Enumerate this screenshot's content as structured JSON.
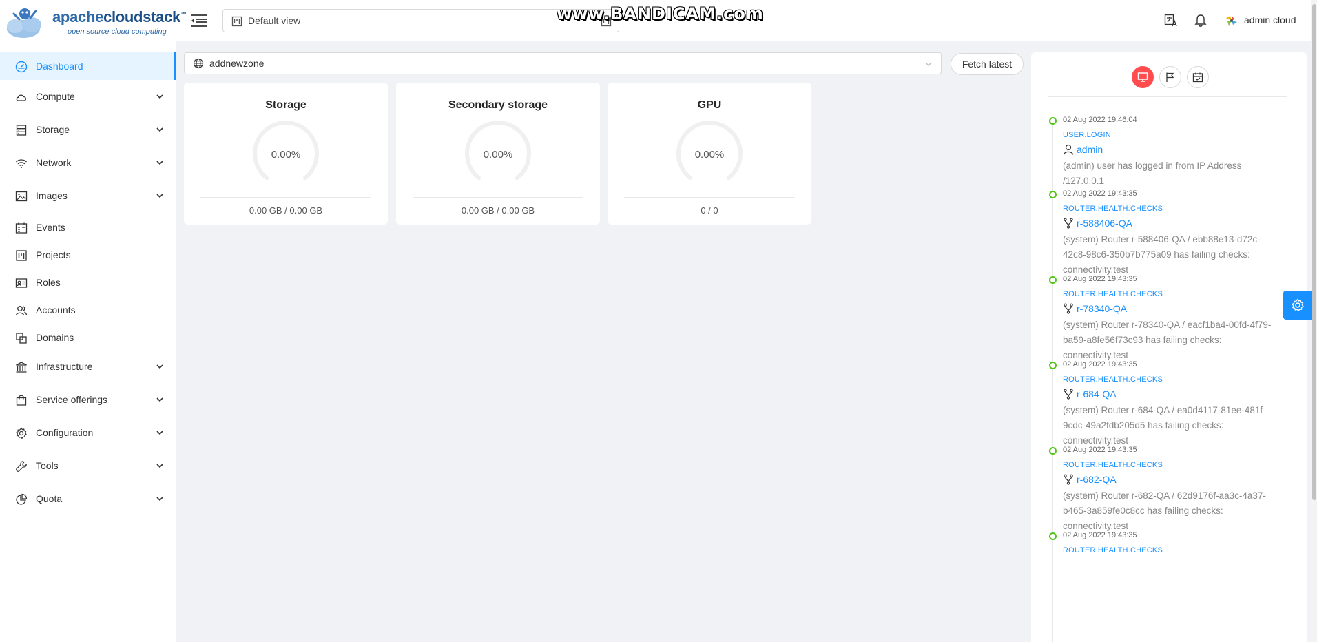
{
  "brand": {
    "word_light": "apache",
    "word_bold": "cloudstack",
    "tm": "™",
    "tagline": "open source cloud computing"
  },
  "header": {
    "view_select": "Default view",
    "user_name": "admin cloud",
    "watermark": "www.BANDICAM.com"
  },
  "sidebar": {
    "items": [
      {
        "label": "Dashboard",
        "icon": "dashboard-icon",
        "active": true,
        "expandable": false
      },
      {
        "label": "Compute",
        "icon": "cloud-icon",
        "expandable": true
      },
      {
        "label": "Storage",
        "icon": "database-icon",
        "expandable": true
      },
      {
        "label": "Network",
        "icon": "wifi-icon",
        "expandable": true
      },
      {
        "label": "Images",
        "icon": "picture-icon",
        "expandable": true
      },
      {
        "label": "Events",
        "icon": "schedule-icon",
        "expandable": false
      },
      {
        "label": "Projects",
        "icon": "project-icon",
        "expandable": false
      },
      {
        "label": "Roles",
        "icon": "idcard-icon",
        "expandable": false
      },
      {
        "label": "Accounts",
        "icon": "team-icon",
        "expandable": false
      },
      {
        "label": "Domains",
        "icon": "block-icon",
        "expandable": false
      },
      {
        "label": "Infrastructure",
        "icon": "bank-icon",
        "expandable": true
      },
      {
        "label": "Service offerings",
        "icon": "shopping-icon",
        "expandable": true
      },
      {
        "label": "Configuration",
        "icon": "setting-icon",
        "expandable": true
      },
      {
        "label": "Tools",
        "icon": "tool-icon",
        "expandable": true
      },
      {
        "label": "Quota",
        "icon": "pie-chart-icon",
        "expandable": true
      }
    ]
  },
  "main": {
    "zone_select": "addnewzone",
    "fetch_button": "Fetch latest",
    "cards": [
      {
        "title": "Storage",
        "percent": "0.00%",
        "usage_value": 0,
        "footer": "0.00 GB / 0.00 GB"
      },
      {
        "title": "Secondary storage",
        "percent": "0.00%",
        "usage_value": 0,
        "footer": "0.00 GB / 0.00 GB"
      },
      {
        "title": "GPU",
        "percent": "0.00%",
        "usage_value": 0,
        "footer": "0 / 0"
      }
    ]
  },
  "events_panel": {
    "tabs": [
      "desktop-icon",
      "flag-icon",
      "calendar-icon"
    ],
    "events": [
      {
        "time": "02 Aug 2022 19:46:04",
        "type": "USER.LOGIN",
        "resource_icon": "user-icon",
        "resource": "admin",
        "desc_lines": [
          "(admin) user has logged in from IP Address",
          "/127.0.0.1"
        ]
      },
      {
        "time": "02 Aug 2022 19:43:35",
        "type": "ROUTER.HEALTH.CHECKS",
        "resource_icon": "fork-icon",
        "resource": "r-588406-QA",
        "desc_lines": [
          "(system) Router r-588406-QA / ebb88e13-d72c-",
          "42c8-98c6-350b7b775a09 has failing checks:",
          "connectivity.test"
        ]
      },
      {
        "time": "02 Aug 2022 19:43:35",
        "type": "ROUTER.HEALTH.CHECKS",
        "resource_icon": "fork-icon",
        "resource": "r-78340-QA",
        "desc_lines": [
          "(system) Router r-78340-QA / eacf1ba4-00fd-4f79-",
          "ba59-a8fe56f73c93 has failing checks:",
          "connectivity.test"
        ]
      },
      {
        "time": "02 Aug 2022 19:43:35",
        "type": "ROUTER.HEALTH.CHECKS",
        "resource_icon": "fork-icon",
        "resource": "r-684-QA",
        "desc_lines": [
          "(system) Router r-684-QA / ea0d4117-81ee-481f-",
          "9cdc-49a2fdb205d5 has failing checks:",
          "connectivity.test"
        ]
      },
      {
        "time": "02 Aug 2022 19:43:35",
        "type": "ROUTER.HEALTH.CHECKS",
        "resource_icon": "fork-icon",
        "resource": "r-682-QA",
        "desc_lines": [
          "(system) Router r-682-QA / 62d9176f-aa3c-4a37-",
          "b465-3a859fe0c8cc has failing checks:",
          "connectivity.test"
        ]
      },
      {
        "time": "02 Aug 2022 19:43:35",
        "type": "ROUTER.HEALTH.CHECKS",
        "resource_icon": "fork-icon",
        "resource": "",
        "desc_lines": []
      }
    ]
  },
  "colors": {
    "accent": "#1890ff",
    "danger": "#ff4d4f",
    "success": "#52c41a",
    "background": "#f0f2f5"
  }
}
